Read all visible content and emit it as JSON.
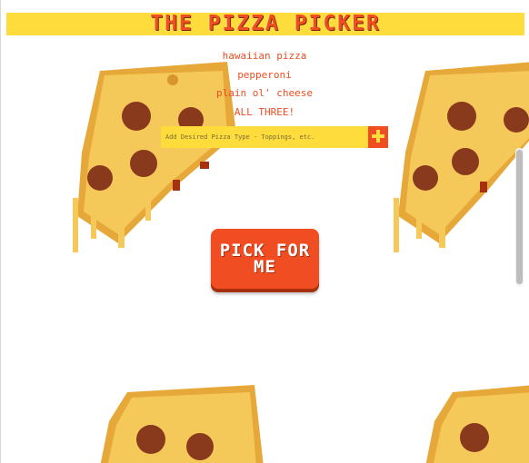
{
  "app": {
    "title": "THE PIZZA PICKER"
  },
  "options": [
    "hawaiian pizza",
    "pepperoni",
    "plain ol' cheese",
    "ALL THREE!"
  ],
  "add_form": {
    "placeholder": "Add Desired Pizza Type - Toppings, etc.",
    "button_icon": "plus-icon"
  },
  "pick_button": {
    "label": "PICK FOR ME"
  },
  "colors": {
    "banner_bg": "#fddc3b",
    "accent": "#f04d23",
    "cheese": "#f2c14e",
    "crust": "#e7a83a",
    "pepperoni": "#8a3a1c"
  }
}
